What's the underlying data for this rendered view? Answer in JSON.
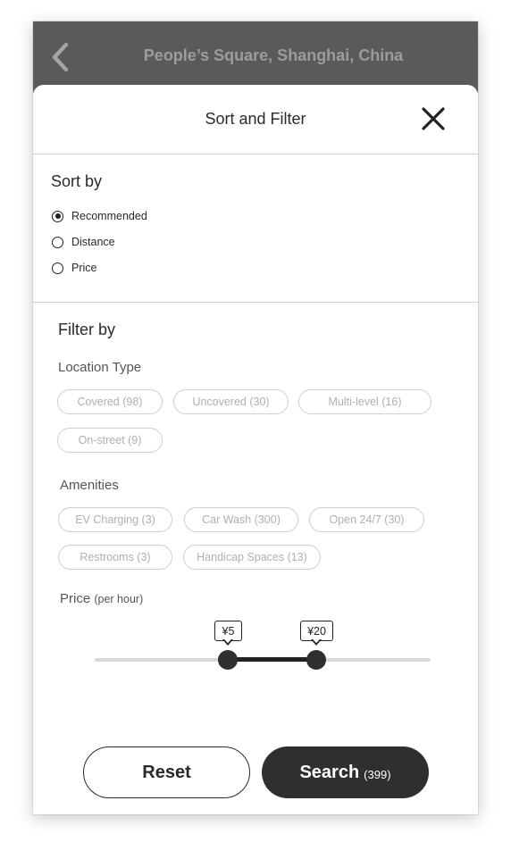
{
  "topbar": {
    "title": "People’s Square, Shanghai, China"
  },
  "sheet": {
    "title": "Sort and Filter"
  },
  "sort": {
    "heading": "Sort by",
    "options": [
      {
        "label": "Recommended",
        "selected": true
      },
      {
        "label": "Distance",
        "selected": false
      },
      {
        "label": "Price",
        "selected": false
      }
    ]
  },
  "filter": {
    "heading": "Filter by",
    "location_type": {
      "heading": "Location Type",
      "chips": [
        "Covered (98)",
        "Uncovered (30)",
        "Multi-level (16)",
        "On-street (9)"
      ]
    },
    "amenities": {
      "heading": "Amenities",
      "chips": [
        "EV Charging (3)",
        "Car Wash (300)",
        "Open 24/7 (30)",
        "Restrooms (3)",
        "Handicap Spaces (13)"
      ]
    },
    "price": {
      "heading": "Price",
      "unit": "(per hour)",
      "min_label": "¥5",
      "max_label": "¥20"
    }
  },
  "buttons": {
    "reset": "Reset",
    "search": "Search",
    "search_count": "(399)"
  },
  "colors": {
    "topbar": "#5a5a5a",
    "accent": "#2f2f2f",
    "chip_text": "#b0b0b0"
  },
  "icons": {
    "back": "chevron-left-icon",
    "close": "close-icon"
  }
}
